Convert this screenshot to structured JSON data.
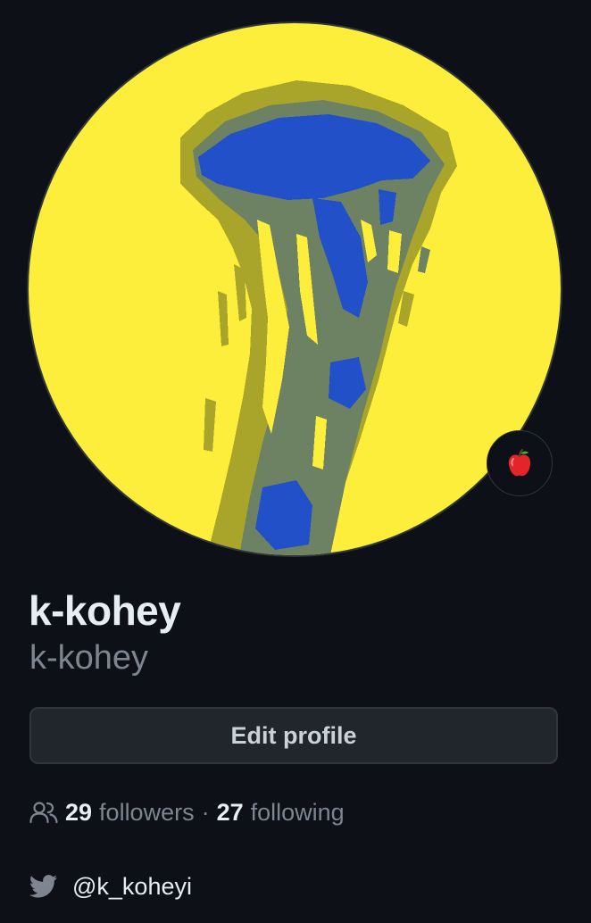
{
  "profile": {
    "full_name": "k-kohey",
    "username": "k-kohey",
    "avatar_alt": "jellyfish pixel art avatar",
    "status_emoji": "apple-emoji"
  },
  "actions": {
    "edit_profile_label": "Edit profile"
  },
  "stats": {
    "followers_count": "29",
    "followers_label": "followers",
    "separator": "·",
    "following_count": "27",
    "following_label": "following",
    "icon": "people-icon"
  },
  "social": {
    "twitter_icon": "twitter-icon",
    "twitter_handle": "@k_koheyi"
  },
  "colors": {
    "background": "#0d1117",
    "avatar_yellow": "#fcee3a",
    "jelly_blue": "#2150c8",
    "jelly_olive": "#a8a52a",
    "jelly_grey": "#6d8262",
    "button_bg": "#21262d",
    "border": "#30363d",
    "text_primary": "#e6edf3",
    "text_muted": "#7d8590"
  }
}
